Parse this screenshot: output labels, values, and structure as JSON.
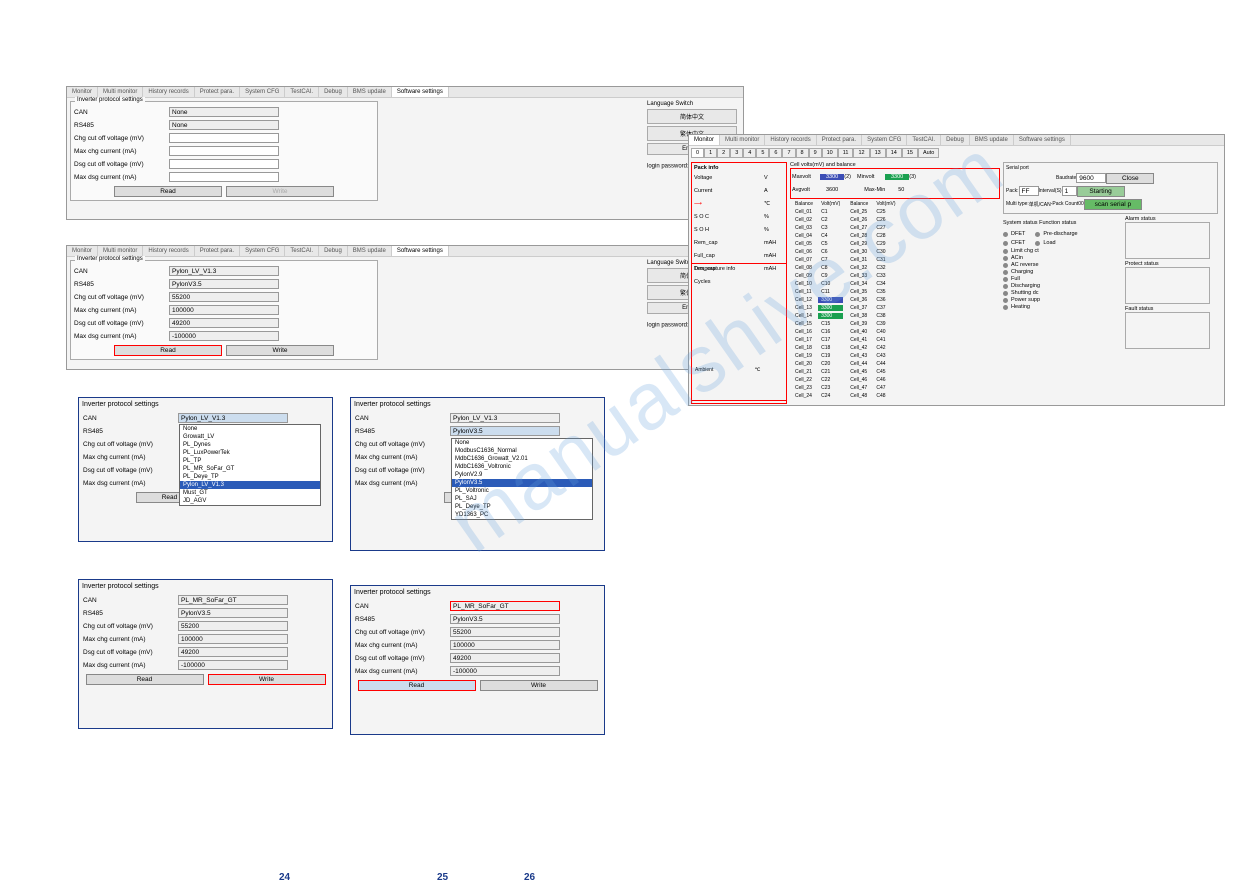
{
  "watermark": "manualshive.com",
  "tabs": [
    "Monitor",
    "Multi monitor",
    "History records",
    "Protect para.",
    "System CFG",
    "TestCAI.",
    "Debug",
    "BMS update",
    "Software settings"
  ],
  "lang_section": "Language Switch",
  "lang_btns": {
    "cn1": "简体中文",
    "cn2": "繁体中文",
    "en": "English"
  },
  "login_label": "login password:",
  "panel1": {
    "title": "Inverter protocol settings",
    "can": "CAN",
    "can_val": "None",
    "rs485": "RS485",
    "rs485_val": "None",
    "chg": "Chg cut off voltage (mV)",
    "maxchg": "Max chg current (mA)",
    "dsg": "Dsg cut off voltage (mV)",
    "maxdsg": "Max dsg current (mA)",
    "read": "Read",
    "write": "Write"
  },
  "panel2": {
    "title": "Inverter protocol settings",
    "can_val": "Pylon_LV_V1.3",
    "rs485_val": "PylonV3.5",
    "chg_val": "55200",
    "maxchg_val": "100000",
    "dsg_val": "49200",
    "maxdsg_val": "-100000"
  },
  "panel3": {
    "title": "Inverter protocol settings",
    "can_val": "Pylon_LV_V1.3",
    "dropdown": [
      "None",
      "Growatt_LV",
      "PL_Dynes",
      "PL_LuxPowerTek",
      "PL_TP",
      "PL_MR_SoFar_GT",
      "PL_Deye_TP",
      "Pylon_LV_V1.3",
      "Must_GT",
      "JD_AGV"
    ]
  },
  "panel4": {
    "title": "Inverter protocol settings",
    "can_val": "Pylon_LV_V1.3",
    "rs485_val": "PylonV3.5",
    "dropdown": [
      "None",
      "ModbusC1636_Normal",
      "MdbC1636_Growatt_V2.01",
      "MdbC1636_Voltronic",
      "PylonV2.9",
      "PylonV3.5",
      "PL_Voltronic",
      "PL_SAJ",
      "PL_Deye_TP",
      "YD1363_PC"
    ]
  },
  "panel5": {
    "title": "Inverter protocol settings",
    "can_val": "PL_MR_SoFar_GT",
    "rs485_val": "PylonV3.5",
    "chg_val": "55200",
    "maxchg_val": "100000",
    "dsg_val": "49200",
    "maxdsg_val": "-100000"
  },
  "panel6": {
    "title": "Inverter protocol settings",
    "can_val": "PL_MR_SoFar_GT",
    "rs485_val": "PylonV3.5",
    "chg_val": "55200",
    "maxchg_val": "100000",
    "dsg_val": "49200",
    "maxdsg_val": "-100000"
  },
  "monitor": {
    "serial": {
      "label": "Serial port",
      "baud": "Baudrate",
      "baud_val": "9600",
      "close": "Close",
      "pack": "Pack:",
      "pack_val": "FF",
      "interval": "Interval(S)",
      "interval_val": "1",
      "start": "Starting",
      "multi": "Multi type:",
      "multi_val": "单机/CAN",
      "packcount": "Pack Count",
      "packcount_val": "00",
      "btn": "scan serial p"
    },
    "packinfo": {
      "title": "Pack info",
      "voltage": "Voltage",
      "v": "V",
      "current": "Current",
      "a": "A",
      "soc_u": "℃",
      "soc": "S O C",
      "pct": "%",
      "soh": "S O H",
      "remcap": "Rem_cap",
      "mah": "mAH",
      "fullcap": "Full_cap",
      "dsgcap": "Des_cap",
      "cycles": "Cycles"
    },
    "cellv": {
      "title": "Cell volts(mV) and balance",
      "maxvolt": "Maxvolt",
      "maxvolt_v": "3300",
      "maxvolt_n": "(2)",
      "minvolt": "Minvolt",
      "minvolt_v": "3300",
      "minvolt_n": "(3)",
      "avgvolt": "Avgvolt",
      "avgvolt_v": "3600",
      "maxmin": "Max-Min",
      "maxmin_v": "50",
      "hdr1": "Balance",
      "hdr2": "Volt(mV)",
      "hdr3": "Balance",
      "hdr4": "Volt(mV)"
    },
    "cells_left": [
      [
        "Cell_01",
        "C1"
      ],
      [
        "Cell_02",
        "C2"
      ],
      [
        "Cell_03",
        "C3"
      ],
      [
        "Cell_04",
        "C4"
      ],
      [
        "Cell_05",
        "C5"
      ],
      [
        "Cell_06",
        "C6"
      ],
      [
        "Cell_07",
        "C7"
      ],
      [
        "Cell_08",
        "C8"
      ],
      [
        "Cell_09",
        "C9"
      ],
      [
        "Cell_10",
        "C10"
      ],
      [
        "Cell_11",
        "C11"
      ],
      [
        "Cell_12",
        "3300"
      ],
      [
        "Cell_13",
        "3300"
      ],
      [
        "Cell_14",
        "3300"
      ],
      [
        "Cell_15",
        "C15"
      ],
      [
        "Cell_16",
        "C16"
      ],
      [
        "Cell_17",
        "C17"
      ],
      [
        "Cell_18",
        "C18"
      ],
      [
        "Cell_19",
        "C19"
      ],
      [
        "Cell_20",
        "C20"
      ],
      [
        "Cell_21",
        "C21"
      ],
      [
        "Cell_22",
        "C22"
      ],
      [
        "Cell_23",
        "C23"
      ],
      [
        "Cell_24",
        "C24"
      ]
    ],
    "cells_right": [
      [
        "Cell_25",
        "C25"
      ],
      [
        "Cell_26",
        "C26"
      ],
      [
        "Cell_27",
        "C27"
      ],
      [
        "Cell_28",
        "C28"
      ],
      [
        "Cell_29",
        "C29"
      ],
      [
        "Cell_30",
        "C30"
      ],
      [
        "Cell_31",
        "C31"
      ],
      [
        "Cell_32",
        "C32"
      ],
      [
        "Cell_33",
        "C33"
      ],
      [
        "Cell_34",
        "C34"
      ],
      [
        "Cell_35",
        "C35"
      ],
      [
        "Cell_36",
        "C36"
      ],
      [
        "Cell_37",
        "C37"
      ],
      [
        "Cell_38",
        "C38"
      ],
      [
        "Cell_39",
        "C39"
      ],
      [
        "Cell_40",
        "C40"
      ],
      [
        "Cell_41",
        "C41"
      ],
      [
        "Cell_42",
        "C42"
      ],
      [
        "Cell_43",
        "C43"
      ],
      [
        "Cell_44",
        "C44"
      ],
      [
        "Cell_45",
        "C45"
      ],
      [
        "Cell_46",
        "C46"
      ],
      [
        "Cell_47",
        "C47"
      ],
      [
        "Cell_48",
        "C48"
      ]
    ],
    "temp": {
      "title": "Temperature info",
      "ambient": "Ambient",
      "c": "℃"
    },
    "sys": {
      "title": "System status",
      "func": "Function status"
    },
    "status_l": [
      "DFET",
      "CFET",
      "Limit chg ct",
      "ACin",
      "AC reverse",
      "Charging",
      "Full",
      "Discharging",
      "Shutting dc",
      "Power supp",
      "Heating"
    ],
    "status_r": [
      "Pre-discharge",
      "Load"
    ],
    "alarm": "Alarm status",
    "protect": "Protect status",
    "fault": "Fault status"
  },
  "pages": {
    "p1": "24",
    "p2": "25",
    "p3": "26"
  }
}
